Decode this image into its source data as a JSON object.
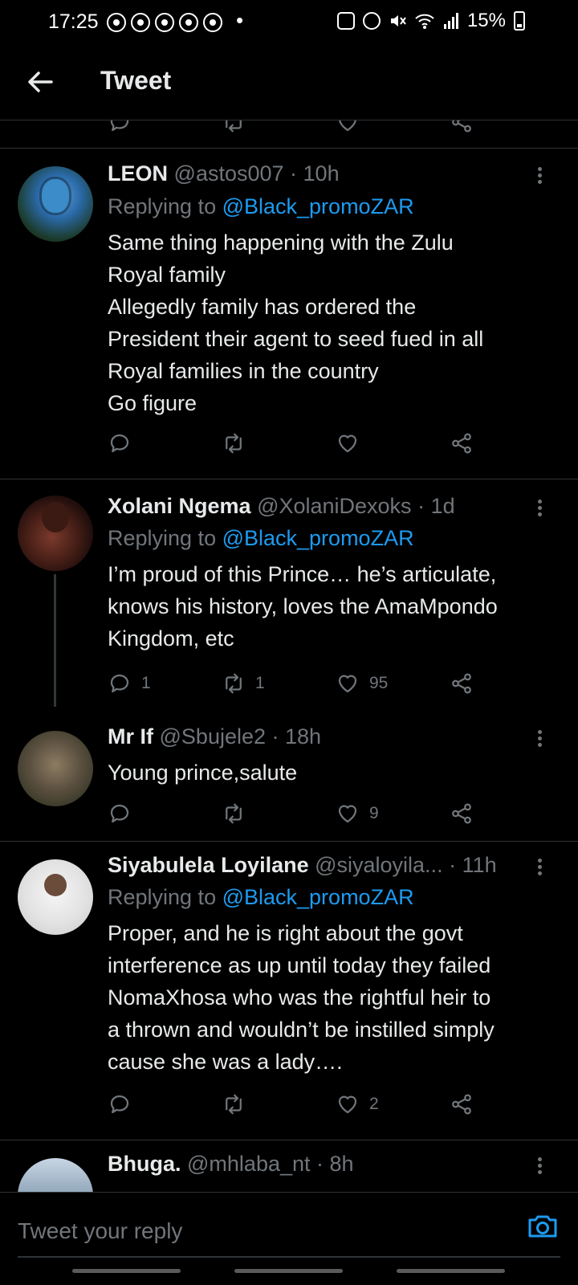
{
  "status_bar": {
    "time": "17:25",
    "bullet": "•",
    "battery": "15%"
  },
  "header": {
    "title": "Tweet"
  },
  "tweets": [
    {
      "name": "LEON",
      "handle": "@astos007",
      "dot": " · ",
      "time": "10h",
      "reply_prefix": "Replying to ",
      "reply_to": "@Black_promoZAR",
      "body_lines": [
        "Same thing happening with the Zulu",
        "Royal family",
        "Allegedly family has ordered the",
        "President their agent to seed fued in all",
        "Royal families in the country",
        "Go figure"
      ],
      "replies": "",
      "retweets": "",
      "likes": ""
    },
    {
      "name": "Xolani Ngema",
      "handle": "@XolaniDexoks",
      "dot": " · ",
      "time": "1d",
      "reply_prefix": "Replying to ",
      "reply_to": "@Black_promoZAR",
      "body_lines": [
        "I’m proud of this Prince… he’s articulate,",
        "knows his history, loves the AmaMpondo",
        "Kingdom, etc"
      ],
      "replies": "1",
      "retweets": "1",
      "likes": "95"
    },
    {
      "name": "Mr If",
      "handle": "@Sbujele2",
      "dot": " · ",
      "time": "18h",
      "body_lines": [
        "Young prince,salute"
      ],
      "replies": "",
      "retweets": "",
      "likes": "9"
    },
    {
      "name": "Siyabulela Loyilane",
      "handle": "@siyaloyila...",
      "dot": " · ",
      "time": "11h",
      "reply_prefix": "Replying to ",
      "reply_to": "@Black_promoZAR",
      "body_lines": [
        "Proper, and he is right about the govt",
        "interference as up until today they failed",
        "NomaXhosa who was the rightful heir to",
        "a thrown and wouldn’t be instilled simply",
        "cause she was a lady…."
      ],
      "replies": "",
      "retweets": "",
      "likes": "2"
    },
    {
      "name": "Bhuga.",
      "handle": "@mhlaba_nt",
      "dot": " · ",
      "time": "8h"
    }
  ],
  "composer": {
    "placeholder": "Tweet your reply"
  },
  "colors": {
    "background": "#000000",
    "link": "#1d9bf0",
    "muted": "#71767b",
    "text": "#e7e9ea"
  },
  "icons": {
    "back": "arrow-left-icon",
    "more": "more-vertical-icon",
    "reply": "reply-icon",
    "retweet": "retweet-icon",
    "like": "heart-icon",
    "share": "share-icon",
    "camera": "camera-icon"
  }
}
